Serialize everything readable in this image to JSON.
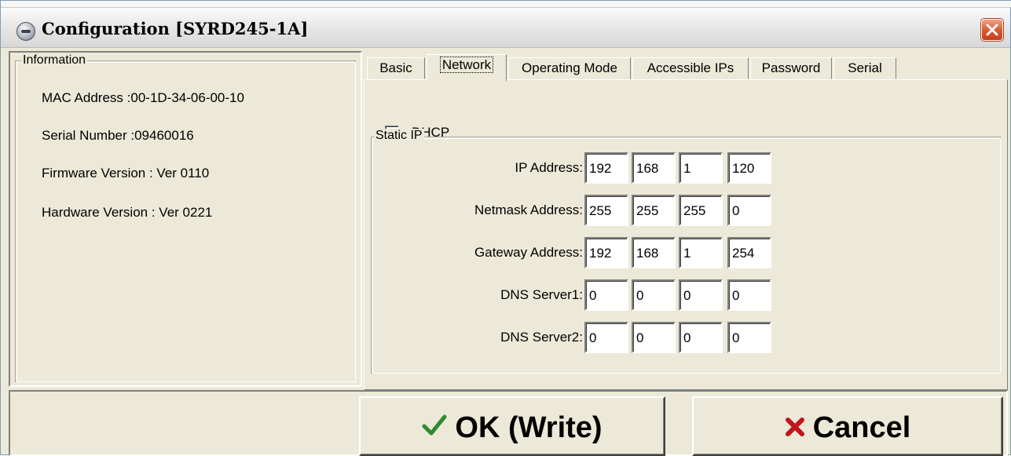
{
  "window": {
    "title": "Configuration [SYRD245-1A]",
    "icon": "device-icon",
    "close_icon": "close-icon"
  },
  "information": {
    "legend": "Information",
    "mac_address": "MAC Address :00-1D-34-06-00-10",
    "serial_number": "Serial Number :09460016",
    "firmware_version": "Firmware Version : Ver 0110",
    "hardware_version": "Hardware Version : Ver 0221"
  },
  "tabs": [
    {
      "label": "Basic",
      "active": false
    },
    {
      "label": "Network",
      "active": true
    },
    {
      "label": "Operating Mode",
      "active": false
    },
    {
      "label": "Accessible IPs",
      "active": false
    },
    {
      "label": "Password",
      "active": false
    },
    {
      "label": "Serial",
      "active": false
    }
  ],
  "network": {
    "dhcp_label": "DHCP",
    "dhcp_checked": false,
    "static_ip_legend": "Static IP",
    "rows": [
      {
        "label": "IP Address:",
        "octets": [
          "192",
          "168",
          "1",
          "120"
        ]
      },
      {
        "label": "Netmask Address:",
        "octets": [
          "255",
          "255",
          "255",
          "0"
        ]
      },
      {
        "label": "Gateway Address:",
        "octets": [
          "192",
          "168",
          "1",
          "254"
        ]
      },
      {
        "label": "DNS Server1:",
        "octets": [
          "0",
          "0",
          "0",
          "0"
        ]
      },
      {
        "label": "DNS Server2:",
        "octets": [
          "0",
          "0",
          "0",
          "0"
        ]
      }
    ]
  },
  "buttons": {
    "ok_label": "OK (Write)",
    "ok_icon": "checkmark-icon",
    "cancel_label": "Cancel",
    "cancel_icon": "x-mark-icon"
  },
  "colors": {
    "ok_check": "#2e8b2e",
    "cancel_x": "#c0161b",
    "close_button": "#d9552d"
  }
}
